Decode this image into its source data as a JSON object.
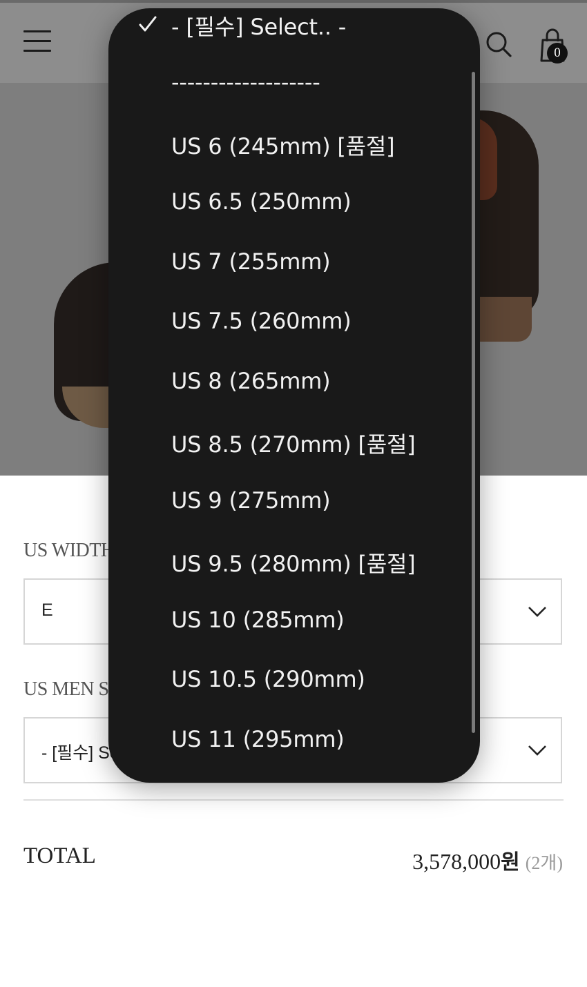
{
  "header": {
    "menu_icon": "hamburger-menu-icon",
    "search_icon": "search-icon",
    "cart_icon": "shopping-bag-icon",
    "cart_count": "0"
  },
  "form": {
    "width_label": "US WIDTH",
    "width_value": "E",
    "size_label": "US MEN SIZE",
    "size_value": "- [필수] Select.. -"
  },
  "total": {
    "label": "TOTAL",
    "price": "3,578,000",
    "currency": "원",
    "qty": "(2개)"
  },
  "dropdown": {
    "selected_index": 0,
    "options": [
      "- [필수] Select.. -",
      "-------------------",
      "US 6 (245mm) [품절]",
      "US 6.5 (250mm)",
      "US 7 (255mm)",
      "US 7.5 (260mm)",
      "US 8 (265mm)",
      "US 8.5 (270mm) [품절]",
      "US 9 (275mm)",
      "US 9.5 (280mm) [품절]",
      "US 10 (285mm)",
      "US 10.5 (290mm)",
      "US 11 (295mm)"
    ]
  }
}
